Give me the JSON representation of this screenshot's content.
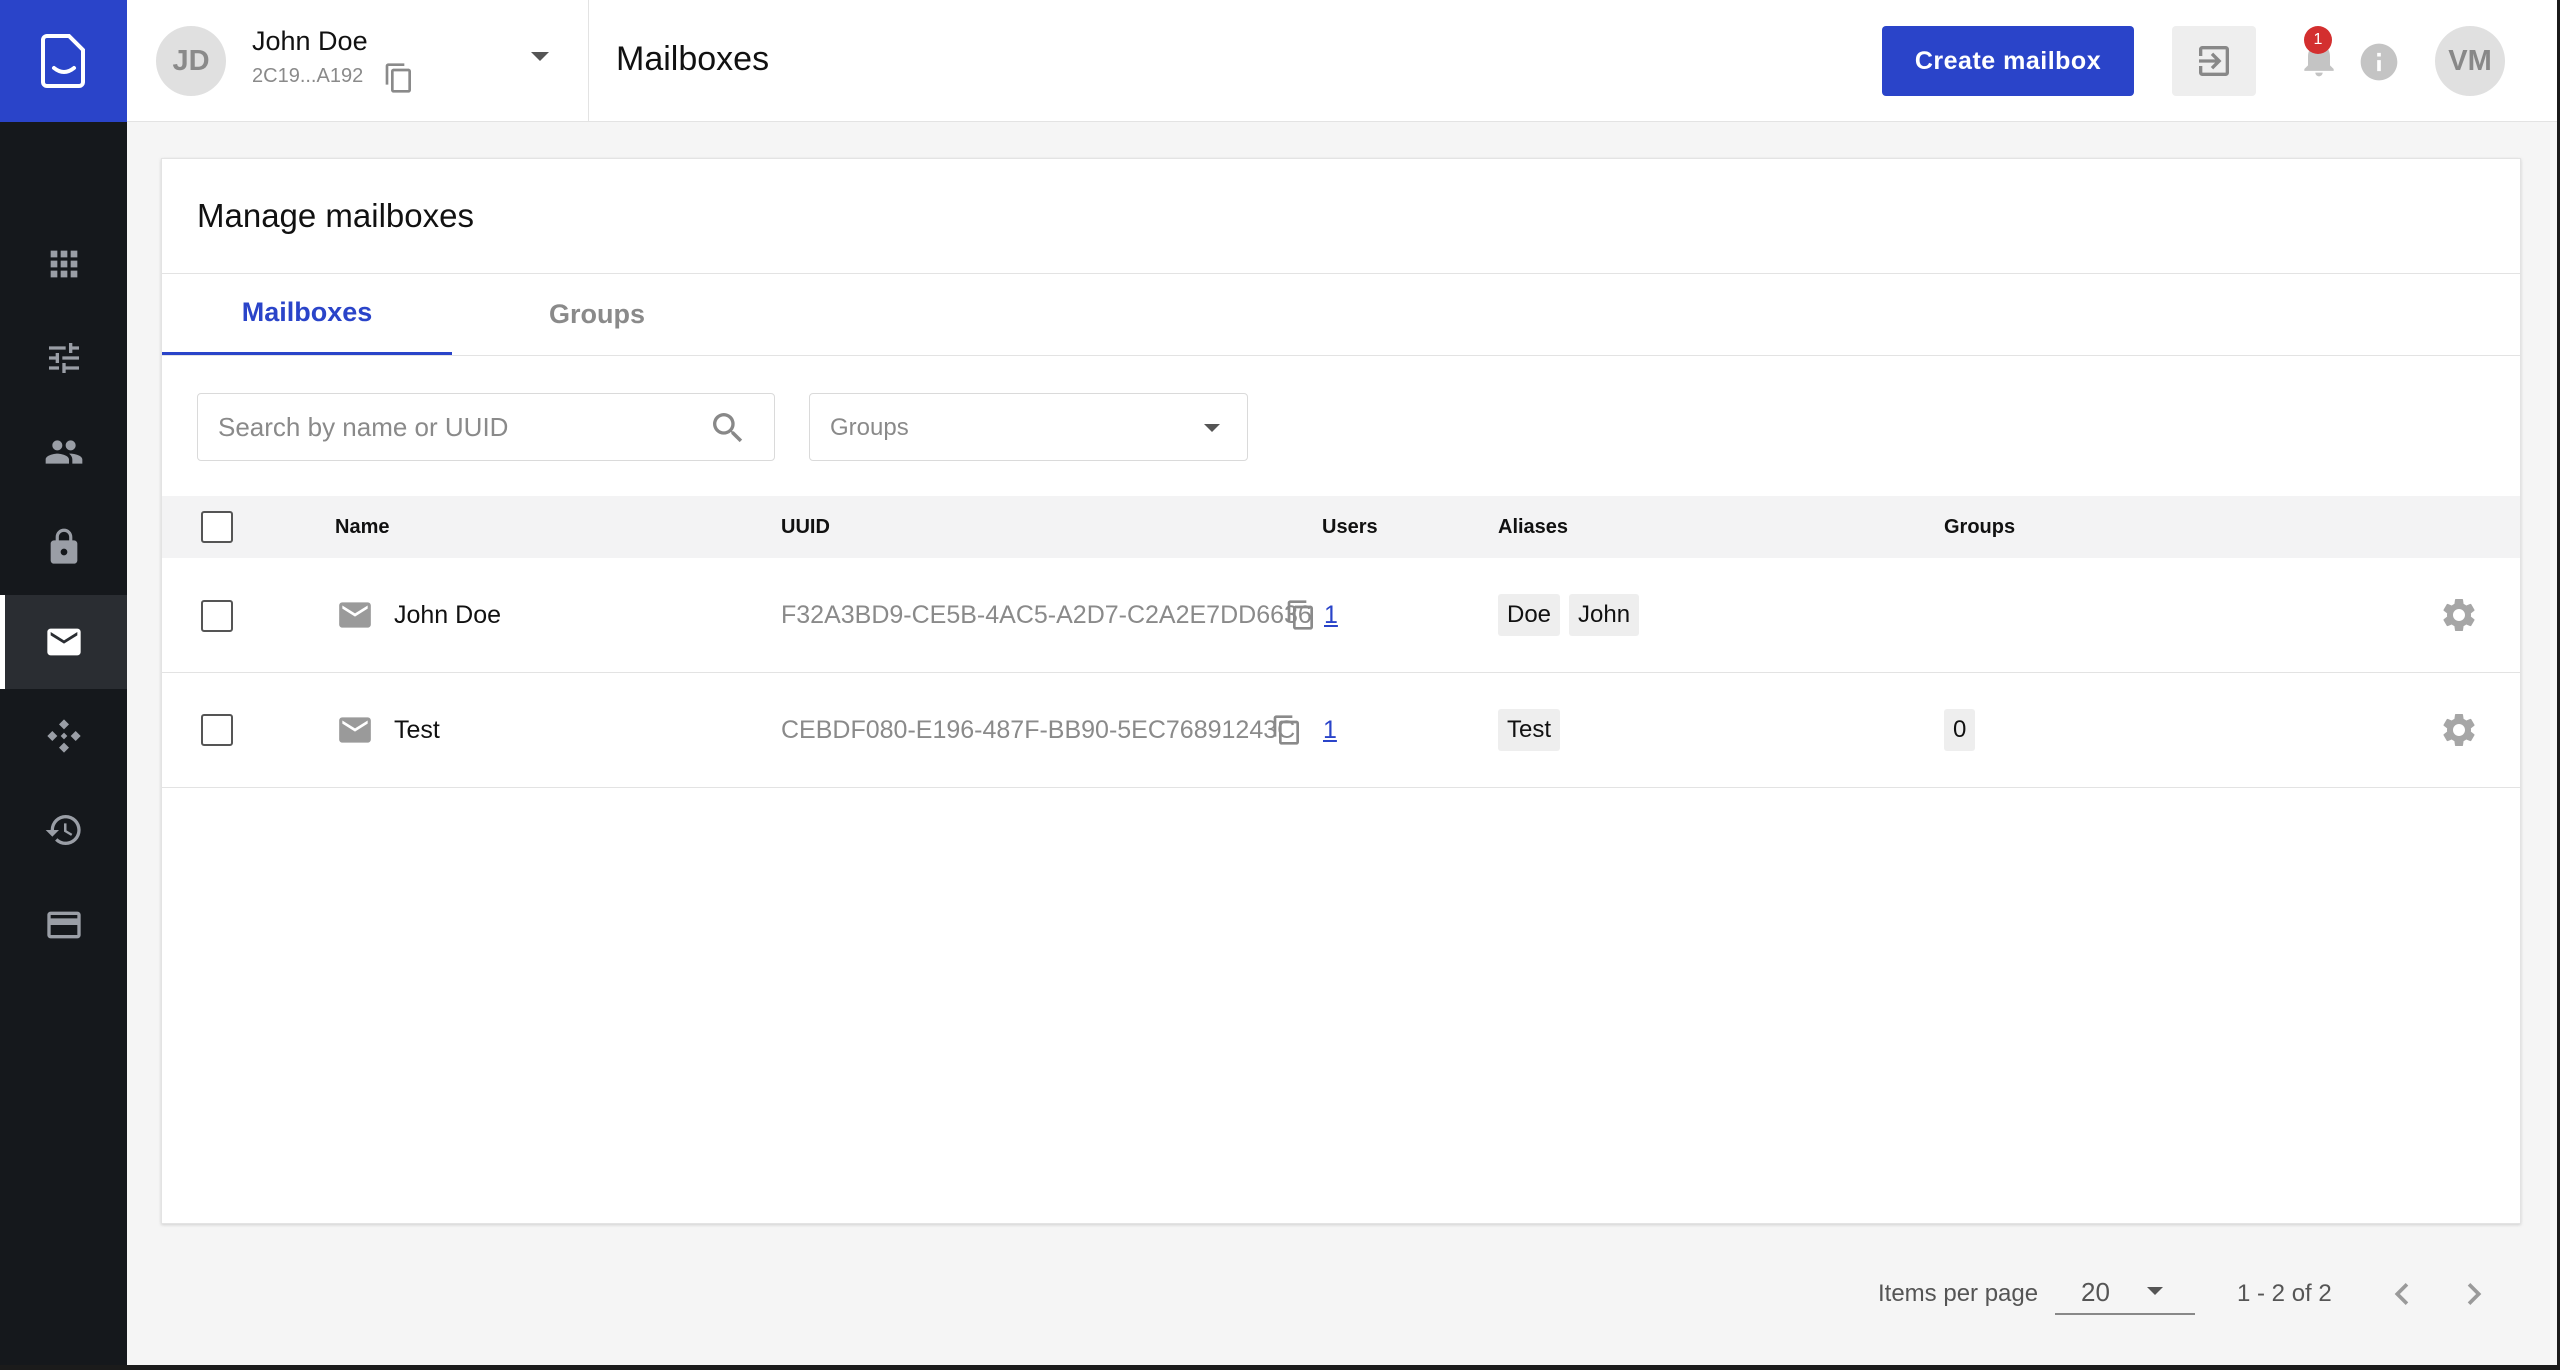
{
  "header": {
    "account_initials": "JD",
    "account_name": "John Doe",
    "account_id": "2C19...A192",
    "page_title": "Mailboxes",
    "create_button": "Create mailbox",
    "notification_count": "1",
    "user_initials": "VM"
  },
  "sidebar": {
    "items": [
      {
        "icon": "apps-grid-icon",
        "active": false
      },
      {
        "icon": "tune-sliders-icon",
        "active": false
      },
      {
        "icon": "people-icon",
        "active": false
      },
      {
        "icon": "lock-icon",
        "active": false
      },
      {
        "icon": "mail-icon",
        "active": true
      },
      {
        "icon": "diamond-network-icon",
        "active": false
      },
      {
        "icon": "history-icon",
        "active": false
      },
      {
        "icon": "credit-card-icon",
        "active": false
      }
    ]
  },
  "card": {
    "title": "Manage mailboxes",
    "tabs": [
      {
        "label": "Mailboxes",
        "active": true
      },
      {
        "label": "Groups",
        "active": false
      }
    ],
    "search_placeholder": "Search by name or UUID",
    "groups_filter_placeholder": "Groups"
  },
  "table": {
    "headers": {
      "name": "Name",
      "uuid": "UUID",
      "users": "Users",
      "aliases": "Aliases",
      "groups": "Groups"
    },
    "rows": [
      {
        "name": "John Doe",
        "uuid": "F32A3BD9-CE5B-4AC5-A2D7-C2A2E7DD6636",
        "users": "1",
        "aliases": [
          "Doe",
          "John"
        ],
        "groups": ""
      },
      {
        "name": "Test",
        "uuid": "CEBDF080-E196-487F-BB90-5EC76891243C",
        "users": "1",
        "aliases": [
          "Test"
        ],
        "groups": "0"
      }
    ]
  },
  "pagination": {
    "items_per_page_label": "Items per page",
    "items_per_page": "20",
    "range": "1 - 2 of 2"
  },
  "colors": {
    "accent": "#2a44c9",
    "sidebar_bg": "#15181c",
    "badge": "#d32f2f"
  }
}
